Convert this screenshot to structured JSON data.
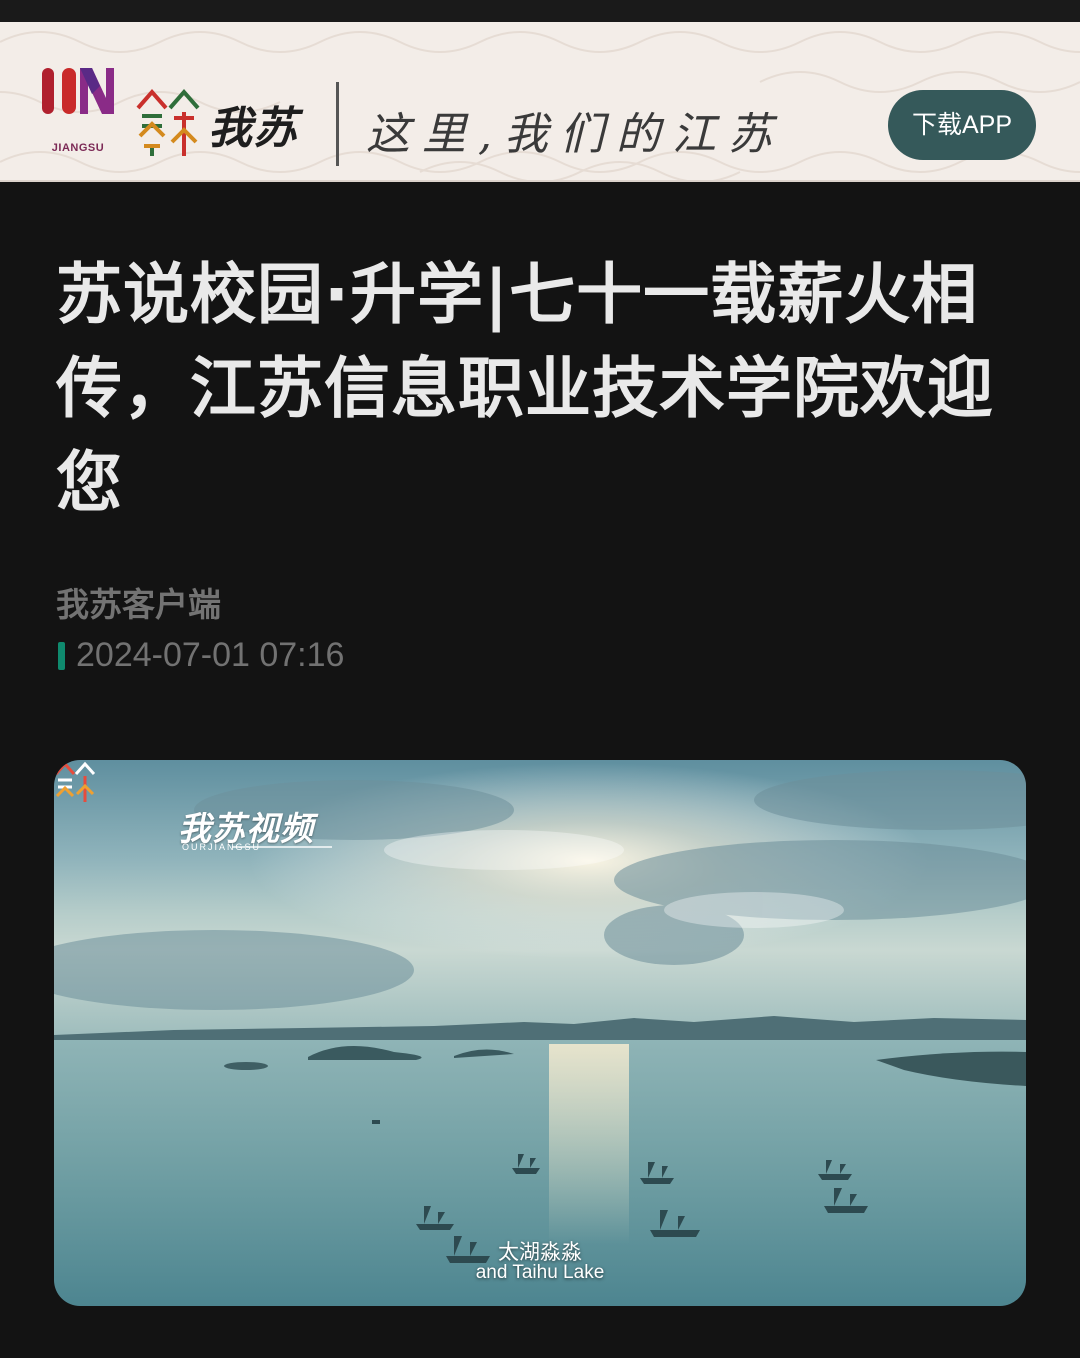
{
  "banner": {
    "logo_sub": "JIANGSU",
    "brand_name": "我苏",
    "slogan": "这里,我们的江苏",
    "download_label": "下载APP"
  },
  "article": {
    "title": "苏说校园·升学|七十一载薪火相传，江苏信息职业技术学院欢迎您",
    "source": "我苏客户端",
    "datetime": "2024-07-01 07:16"
  },
  "video": {
    "watermark": "我苏视频",
    "watermark_sub": "OURJIANGSU",
    "subtitle_cn": "太湖淼淼",
    "subtitle_en": "and Taihu Lake"
  },
  "colors": {
    "page_bg": "#131313",
    "banner_bg": "#f3ede8",
    "button_bg": "#35595a",
    "accent_bar": "#0f8a6e"
  }
}
